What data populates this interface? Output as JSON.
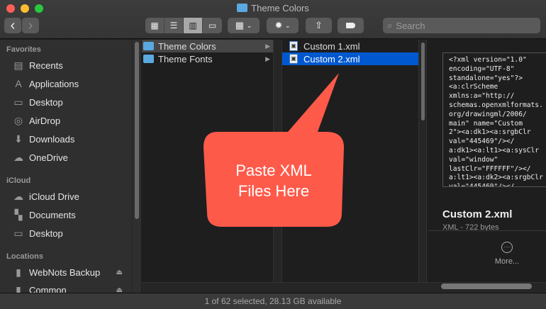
{
  "window": {
    "title": "Theme Colors"
  },
  "toolbar": {
    "back": "‹",
    "forward": "›",
    "search_placeholder": "Search",
    "view_icons": [
      "icon-view-icon",
      "list-view-icon",
      "column-view-icon",
      "gallery-view-icon"
    ],
    "active_view": "column"
  },
  "sidebar": {
    "sections": [
      {
        "label": "Favorites",
        "items": [
          {
            "label": "Recents",
            "icon": "recents-icon"
          },
          {
            "label": "Applications",
            "icon": "applications-icon"
          },
          {
            "label": "Desktop",
            "icon": "desktop-icon"
          },
          {
            "label": "AirDrop",
            "icon": "airdrop-icon"
          },
          {
            "label": "Downloads",
            "icon": "downloads-icon"
          },
          {
            "label": "OneDrive",
            "icon": "cloud-icon"
          }
        ]
      },
      {
        "label": "iCloud",
        "items": [
          {
            "label": "iCloud Drive",
            "icon": "cloud-icon"
          },
          {
            "label": "Documents",
            "icon": "documents-icon"
          },
          {
            "label": "Desktop",
            "icon": "desktop-icon"
          }
        ]
      },
      {
        "label": "Locations",
        "items": [
          {
            "label": "WebNots Backup",
            "icon": "drive-icon"
          },
          {
            "label": "Common",
            "icon": "drive-icon"
          }
        ]
      }
    ]
  },
  "columns": {
    "folders": [
      {
        "label": "Theme Colors",
        "selected": true
      },
      {
        "label": "Theme Fonts",
        "selected": false
      }
    ],
    "files": [
      {
        "label": "Custom 1.xml",
        "selected": false
      },
      {
        "label": "Custom 2.xml",
        "selected": true
      }
    ]
  },
  "preview": {
    "content": "<?xml version=\"1.0\"\nencoding=\"UTF-8\"\nstandalone=\"yes\"?>\n<a:clrScheme\nxmlns:a=\"http://\nschemas.openxmlformats.\norg/drawingml/2006/\nmain\" name=\"Custom\n2\"><a:dk1><a:srgbClr\nval=\"445469\"/></\na:dk1><a:lt1><a:sysClr\nval=\"window\"\nlastClr=\"FFFFFF\"/></\na:lt1><a:dk2><a:srgbClr\nval=\"445469\"/></",
    "name": "Custom 2.xml",
    "info": "XML - 722 bytes",
    "more": "More..."
  },
  "callout": {
    "text_line1": "Paste XML",
    "text_line2": "Files Here",
    "color": "#fe5a4a"
  },
  "status": "1 of 62 selected, 28.13 GB available",
  "colors": {
    "selection": "#0058d0",
    "folder": "#5aa9e0"
  }
}
